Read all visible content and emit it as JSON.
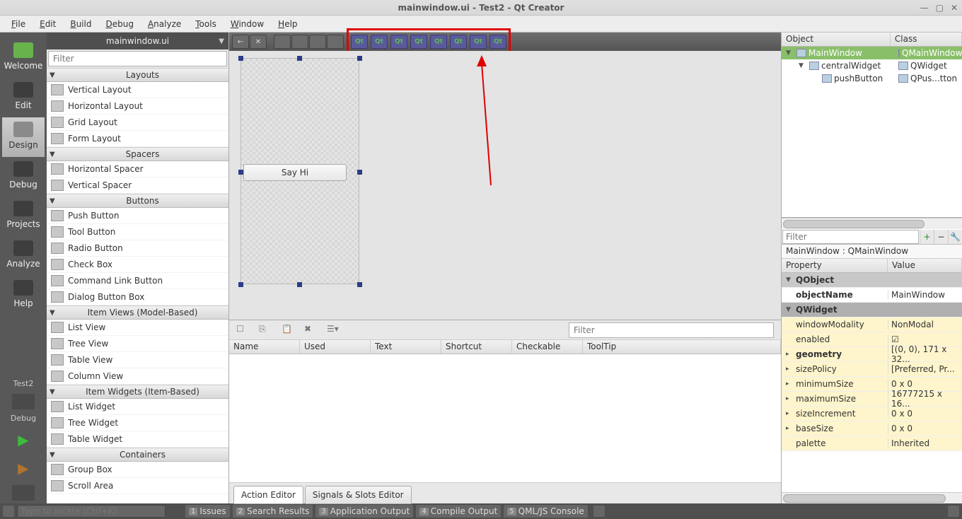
{
  "window_title": "mainwindow.ui - Test2 - Qt Creator",
  "menubar": [
    "File",
    "Edit",
    "Build",
    "Debug",
    "Analyze",
    "Tools",
    "Window",
    "Help"
  ],
  "left_rail": {
    "items": [
      {
        "label": "Welcome"
      },
      {
        "label": "Edit"
      },
      {
        "label": "Design"
      },
      {
        "label": "Debug"
      },
      {
        "label": "Projects"
      },
      {
        "label": "Analyze"
      },
      {
        "label": "Help"
      }
    ],
    "project": "Test2",
    "debug_label": "Debug"
  },
  "widgetbox": {
    "header": "mainwindow.ui",
    "filter_placeholder": "Filter",
    "categories": [
      {
        "name": "Layouts",
        "items": [
          "Vertical Layout",
          "Horizontal Layout",
          "Grid Layout",
          "Form Layout"
        ]
      },
      {
        "name": "Spacers",
        "items": [
          "Horizontal Spacer",
          "Vertical Spacer"
        ]
      },
      {
        "name": "Buttons",
        "items": [
          "Push Button",
          "Tool Button",
          "Radio Button",
          "Check Box",
          "Command Link Button",
          "Dialog Button Box"
        ]
      },
      {
        "name": "Item Views (Model-Based)",
        "items": [
          "List View",
          "Tree View",
          "Table View",
          "Column View"
        ]
      },
      {
        "name": "Item Widgets (Item-Based)",
        "items": [
          "List Widget",
          "Tree Widget",
          "Table Widget"
        ]
      },
      {
        "name": "Containers",
        "items": [
          "Group Box",
          "Scroll Area"
        ]
      }
    ]
  },
  "canvas": {
    "button_text": "Say Hi",
    "qt_icon_count": 8
  },
  "action_panel": {
    "filter_placeholder": "Filter",
    "columns": [
      "Name",
      "Used",
      "Text",
      "Shortcut",
      "Checkable",
      "ToolTip"
    ],
    "tabs": [
      "Action Editor",
      "Signals & Slots Editor"
    ]
  },
  "object_inspector": {
    "columns": [
      "Object",
      "Class"
    ],
    "rows": [
      {
        "name": "MainWindow",
        "class": "QMainWindow",
        "indent": 0,
        "sel": true
      },
      {
        "name": "centralWidget",
        "class": "QWidget",
        "indent": 1
      },
      {
        "name": "pushButton",
        "class": "QPus...tton",
        "indent": 2
      }
    ]
  },
  "property_editor": {
    "filter_placeholder": "Filter",
    "context": "MainWindow : QMainWindow",
    "columns": [
      "Property",
      "Value"
    ],
    "rows": [
      {
        "k": "QObject",
        "cat": true
      },
      {
        "k": "objectName",
        "v": "MainWindow",
        "bold": true
      },
      {
        "k": "QWidget",
        "cat": true,
        "q": true
      },
      {
        "k": "windowModality",
        "v": "NonModal",
        "yellow": true
      },
      {
        "k": "enabled",
        "v": "☑",
        "yellow": true
      },
      {
        "k": "geometry",
        "v": "[(0, 0), 171 x 32...",
        "bold": true,
        "yellow": true,
        "arrow": true
      },
      {
        "k": "sizePolicy",
        "v": "[Preferred, Pr...",
        "yellow": true,
        "arrow": true
      },
      {
        "k": "minimumSize",
        "v": "0 x 0",
        "yellow": true,
        "arrow": true
      },
      {
        "k": "maximumSize",
        "v": "16777215 x 16...",
        "yellow": true,
        "arrow": true
      },
      {
        "k": "sizeIncrement",
        "v": "0 x 0",
        "yellow": true,
        "arrow": true
      },
      {
        "k": "baseSize",
        "v": "0 x 0",
        "yellow": true,
        "arrow": true
      },
      {
        "k": "palette",
        "v": "Inherited",
        "yellow": true
      }
    ]
  },
  "bottombar": {
    "search_placeholder": "Type to locate (Ctrl+K)",
    "tabs": [
      {
        "n": "1",
        "l": "Issues"
      },
      {
        "n": "2",
        "l": "Search Results"
      },
      {
        "n": "3",
        "l": "Application Output"
      },
      {
        "n": "4",
        "l": "Compile Output"
      },
      {
        "n": "5",
        "l": "QML/JS Console"
      }
    ]
  }
}
